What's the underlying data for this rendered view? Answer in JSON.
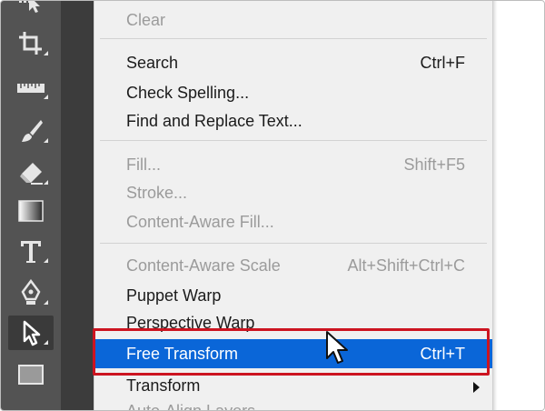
{
  "toolbar": {
    "tools": [
      {
        "name": "artboard-select-icon"
      },
      {
        "name": "crop-icon"
      },
      {
        "name": "ruler-icon"
      },
      {
        "name": "brush-icon"
      },
      {
        "name": "eraser-icon"
      },
      {
        "name": "gradient-icon"
      },
      {
        "name": "type-icon"
      },
      {
        "name": "pen-icon"
      },
      {
        "name": "path-selection-icon"
      },
      {
        "name": "rectangle-icon"
      }
    ]
  },
  "menu": {
    "items": {
      "clear": {
        "label": "Clear"
      },
      "search": {
        "label": "Search",
        "shortcut": "Ctrl+F"
      },
      "check_spelling": {
        "label": "Check Spelling..."
      },
      "find_replace": {
        "label": "Find and Replace Text..."
      },
      "fill": {
        "label": "Fill...",
        "shortcut": "Shift+F5"
      },
      "stroke": {
        "label": "Stroke..."
      },
      "content_aware_fill": {
        "label": "Content-Aware Fill..."
      },
      "content_aware_scale": {
        "label": "Content-Aware Scale",
        "shortcut": "Alt+Shift+Ctrl+C"
      },
      "puppet_warp": {
        "label": "Puppet Warp"
      },
      "perspective_warp": {
        "label": "Perspective Warp"
      },
      "free_transform": {
        "label": "Free Transform",
        "shortcut": "Ctrl+T"
      },
      "transform": {
        "label": "Transform"
      },
      "auto_align_layers": {
        "label": "Auto-Align Layers..."
      }
    }
  },
  "colors": {
    "toolbar_bg": "#535353",
    "menu_bg": "#f0f0f0",
    "highlight": "#0a66d8",
    "callout_border": "#cc1420"
  }
}
